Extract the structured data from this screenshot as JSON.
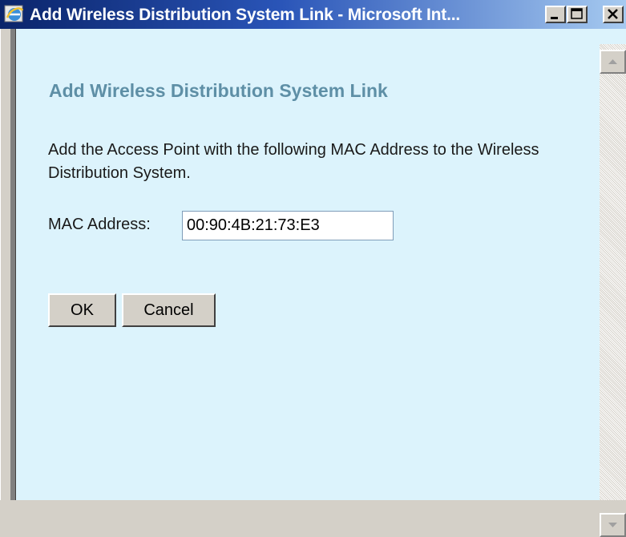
{
  "window": {
    "title": "Add Wireless Distribution System Link - Microsoft Int...",
    "controls": [
      "minimize-icon",
      "maximize-icon",
      "close-icon"
    ]
  },
  "page": {
    "heading": "Add Wireless Distribution System Link",
    "description": "Add the Access Point with the following MAC Address to the Wireless Distribution System.",
    "mac_label": "MAC Address:",
    "mac_value": "00:90:4B:21:73:E3"
  },
  "buttons": {
    "ok": "OK",
    "cancel": "Cancel"
  },
  "colors": {
    "titlebar_start": "#0a246a",
    "titlebar_end": "#a6caf0",
    "content_bg": "#dcf3fc",
    "heading": "#5e8fa6"
  }
}
